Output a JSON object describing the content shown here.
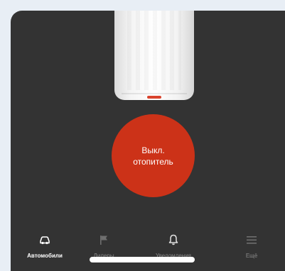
{
  "heater": {
    "label_line1": "Выкл.",
    "label_line2": "отопитель",
    "color": "#cc3218"
  },
  "nav": {
    "items": [
      {
        "label": "Автомобили",
        "icon": "car-icon",
        "active": true
      },
      {
        "label": "Дилеры",
        "icon": "flag-icon",
        "active": false
      },
      {
        "label": "Уведомления",
        "icon": "bell-icon",
        "active": false
      },
      {
        "label": "Ещё",
        "icon": "menu-icon",
        "active": false
      }
    ]
  },
  "colors": {
    "background": "#333333",
    "page": "#e8eef5",
    "active_nav": "#ffffff",
    "inactive_nav": "#8a8a8a"
  }
}
